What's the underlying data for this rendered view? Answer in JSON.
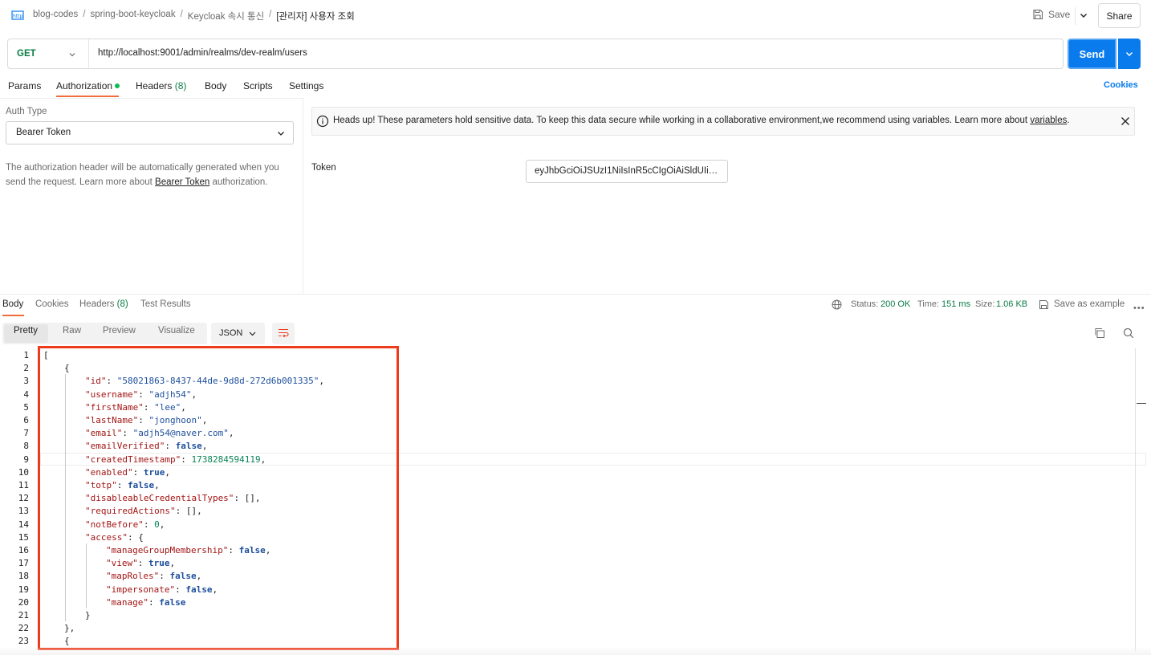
{
  "breadcrumb": {
    "items": [
      "blog-codes",
      "spring-boot-keycloak",
      "Keycloak 속시 통신",
      "[관리자] 사용자 조회"
    ],
    "separator": "/"
  },
  "header": {
    "save_label": "Save",
    "share_label": "Share"
  },
  "request": {
    "method": "GET",
    "url": "http://localhost:9001/admin/realms/dev-realm/users",
    "send_label": "Send"
  },
  "tabs": {
    "params": "Params",
    "authorization": "Authorization",
    "headers": "Headers",
    "headers_count": "(8)",
    "body": "Body",
    "scripts": "Scripts",
    "settings": "Settings",
    "cookies": "Cookies"
  },
  "auth": {
    "type_label": "Auth Type",
    "type_value": "Bearer Token",
    "desc_prefix": "The authorization header will be automatically generated when you send the request. Learn more about ",
    "desc_link": "Bearer Token",
    "desc_suffix": " authorization.",
    "notice_text": "Heads up! These parameters hold sensitive data. To keep this data secure while working in a collaborative environment,we recommend using variables. Learn more about ",
    "notice_link": "variables",
    "notice_end": ".",
    "token_label": "Token",
    "token_value": "eyJhbGciOiJSUzI1NiIsInR5cCIgOiAiSldUIiwi..."
  },
  "response": {
    "tabs": {
      "body": "Body",
      "cookies": "Cookies",
      "headers": "Headers",
      "headers_count": "(8)",
      "test_results": "Test Results"
    },
    "status_label": "Status:",
    "status_value": "200 OK",
    "time_label": "Time:",
    "time_value": "151 ms",
    "size_label": "Size:",
    "size_value": "1.06 KB",
    "save_example": "Save as example",
    "more": "•••",
    "views": {
      "pretty": "Pretty",
      "raw": "Raw",
      "preview": "Preview",
      "visualize": "Visualize"
    },
    "format": "JSON"
  },
  "code_lines": [
    "[",
    "{",
    "\"id\": \"58021863-8437-44de-9d8d-272d6b001335\",",
    "\"username\": \"adjh54\",",
    "\"firstName\": \"lee\",",
    "\"lastName\": \"jonghoon\",",
    "\"email\": \"adjh54@naver.com\",",
    "\"emailVerified\": false,",
    "\"createdTimestamp\": 1738284594119,",
    "\"enabled\": true,",
    "\"totp\": false,",
    "\"disableableCredentialTypes\": [],",
    "\"requiredActions\": [],",
    "\"notBefore\": 0,",
    "\"access\": {",
    "\"manageGroupMembership\": false,",
    "\"view\": true,",
    "\"mapRoles\": false,",
    "\"impersonate\": false,",
    "\"manage\": false",
    "}",
    "},",
    "{"
  ],
  "line_numbers": [
    "1",
    "2",
    "3",
    "4",
    "5",
    "6",
    "7",
    "8",
    "9",
    "10",
    "11",
    "12",
    "13",
    "14",
    "15",
    "16",
    "17",
    "18",
    "19",
    "20",
    "21",
    "22",
    "23"
  ],
  "colors": {
    "accent": "#097bed",
    "method": "#0a7c44",
    "tab_underline": "#f26b3a",
    "highlight_box": "#ee3b1c"
  },
  "icons": [
    "http-icon",
    "save-icon",
    "chevron-down-icon",
    "info-icon",
    "close-icon",
    "globe-icon",
    "copy-icon",
    "search-icon",
    "wrap-icon"
  ]
}
